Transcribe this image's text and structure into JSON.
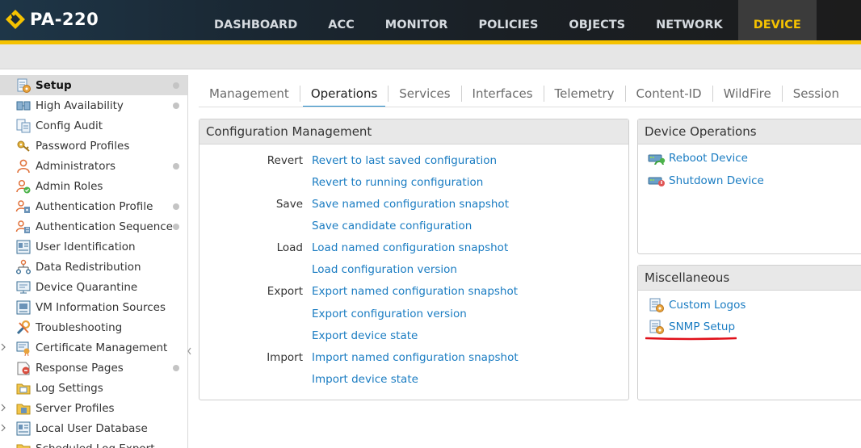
{
  "app": {
    "title": "PA-220"
  },
  "nav": {
    "items": [
      {
        "label": "DASHBOARD",
        "active": false
      },
      {
        "label": "ACC",
        "active": false
      },
      {
        "label": "MONITOR",
        "active": false
      },
      {
        "label": "POLICIES",
        "active": false
      },
      {
        "label": "OBJECTS",
        "active": false
      },
      {
        "label": "NETWORK",
        "active": false
      },
      {
        "label": "DEVICE",
        "active": true
      }
    ]
  },
  "sidebar": {
    "items": [
      {
        "label": "Setup",
        "icon": "setup-gear-icon",
        "selected": true,
        "dot": true,
        "expandable": false
      },
      {
        "label": "High Availability",
        "icon": "high-availability-icon",
        "selected": false,
        "dot": true,
        "expandable": false
      },
      {
        "label": "Config Audit",
        "icon": "config-audit-icon",
        "selected": false,
        "dot": false,
        "expandable": false
      },
      {
        "label": "Password Profiles",
        "icon": "password-key-icon",
        "selected": false,
        "dot": false,
        "expandable": false
      },
      {
        "label": "Administrators",
        "icon": "administrator-user-icon",
        "selected": false,
        "dot": true,
        "expandable": false
      },
      {
        "label": "Admin Roles",
        "icon": "admin-roles-icon",
        "selected": false,
        "dot": false,
        "expandable": false
      },
      {
        "label": "Authentication Profile",
        "icon": "authentication-profile-icon",
        "selected": false,
        "dot": true,
        "expandable": false
      },
      {
        "label": "Authentication Sequence",
        "icon": "authentication-sequence-icon",
        "selected": false,
        "dot": true,
        "expandable": false
      },
      {
        "label": "User Identification",
        "icon": "user-identification-icon",
        "selected": false,
        "dot": false,
        "expandable": false
      },
      {
        "label": "Data Redistribution",
        "icon": "data-redistribution-icon",
        "selected": false,
        "dot": false,
        "expandable": false
      },
      {
        "label": "Device Quarantine",
        "icon": "device-quarantine-icon",
        "selected": false,
        "dot": false,
        "expandable": false
      },
      {
        "label": "VM Information Sources",
        "icon": "vm-information-icon",
        "selected": false,
        "dot": false,
        "expandable": false
      },
      {
        "label": "Troubleshooting",
        "icon": "troubleshooting-wrench-icon",
        "selected": false,
        "dot": false,
        "expandable": false
      },
      {
        "label": "Certificate Management",
        "icon": "certificate-icon",
        "selected": false,
        "dot": false,
        "expandable": true
      },
      {
        "label": "Response Pages",
        "icon": "response-pages-icon",
        "selected": false,
        "dot": true,
        "expandable": false
      },
      {
        "label": "Log Settings",
        "icon": "log-settings-icon",
        "selected": false,
        "dot": false,
        "expandable": false
      },
      {
        "label": "Server Profiles",
        "icon": "server-profiles-folder-icon",
        "selected": false,
        "dot": false,
        "expandable": true
      },
      {
        "label": "Local User Database",
        "icon": "local-user-database-icon",
        "selected": false,
        "dot": false,
        "expandable": true
      },
      {
        "label": "Scheduled Log Export",
        "icon": "scheduled-log-export-icon",
        "selected": false,
        "dot": false,
        "expandable": false
      }
    ]
  },
  "tabs": [
    {
      "label": "Management",
      "active": false
    },
    {
      "label": "Operations",
      "active": true
    },
    {
      "label": "Services",
      "active": false
    },
    {
      "label": "Interfaces",
      "active": false
    },
    {
      "label": "Telemetry",
      "active": false
    },
    {
      "label": "Content-ID",
      "active": false
    },
    {
      "label": "WildFire",
      "active": false
    },
    {
      "label": "Session",
      "active": false
    }
  ],
  "config_management": {
    "title": "Configuration Management",
    "rows": [
      {
        "category": "Revert",
        "link": "Revert to last saved configuration"
      },
      {
        "category": "",
        "link": "Revert to running configuration"
      },
      {
        "category": "Save",
        "link": "Save named configuration snapshot"
      },
      {
        "category": "",
        "link": "Save candidate configuration"
      },
      {
        "category": "Load",
        "link": "Load named configuration snapshot"
      },
      {
        "category": "",
        "link": "Load configuration version"
      },
      {
        "category": "Export",
        "link": "Export named configuration snapshot"
      },
      {
        "category": "",
        "link": "Export configuration version"
      },
      {
        "category": "",
        "link": "Export device state"
      },
      {
        "category": "Import",
        "link": "Import named configuration snapshot"
      },
      {
        "category": "",
        "link": "Import device state"
      }
    ]
  },
  "device_operations": {
    "title": "Device Operations",
    "items": [
      {
        "label": "Reboot Device",
        "icon": "reboot-device-icon"
      },
      {
        "label": "Shutdown Device",
        "icon": "shutdown-device-icon"
      }
    ]
  },
  "miscellaneous": {
    "title": "Miscellaneous",
    "items": [
      {
        "label": "Custom Logos",
        "icon": "custom-logos-gear-icon"
      },
      {
        "label": "SNMP Setup",
        "icon": "snmp-setup-gear-icon"
      }
    ]
  },
  "colors": {
    "accent_yellow": "#f5c200",
    "link_blue": "#1a7cc2",
    "tab_underline": "#1a87c9",
    "annotation_red": "#e0101a"
  }
}
